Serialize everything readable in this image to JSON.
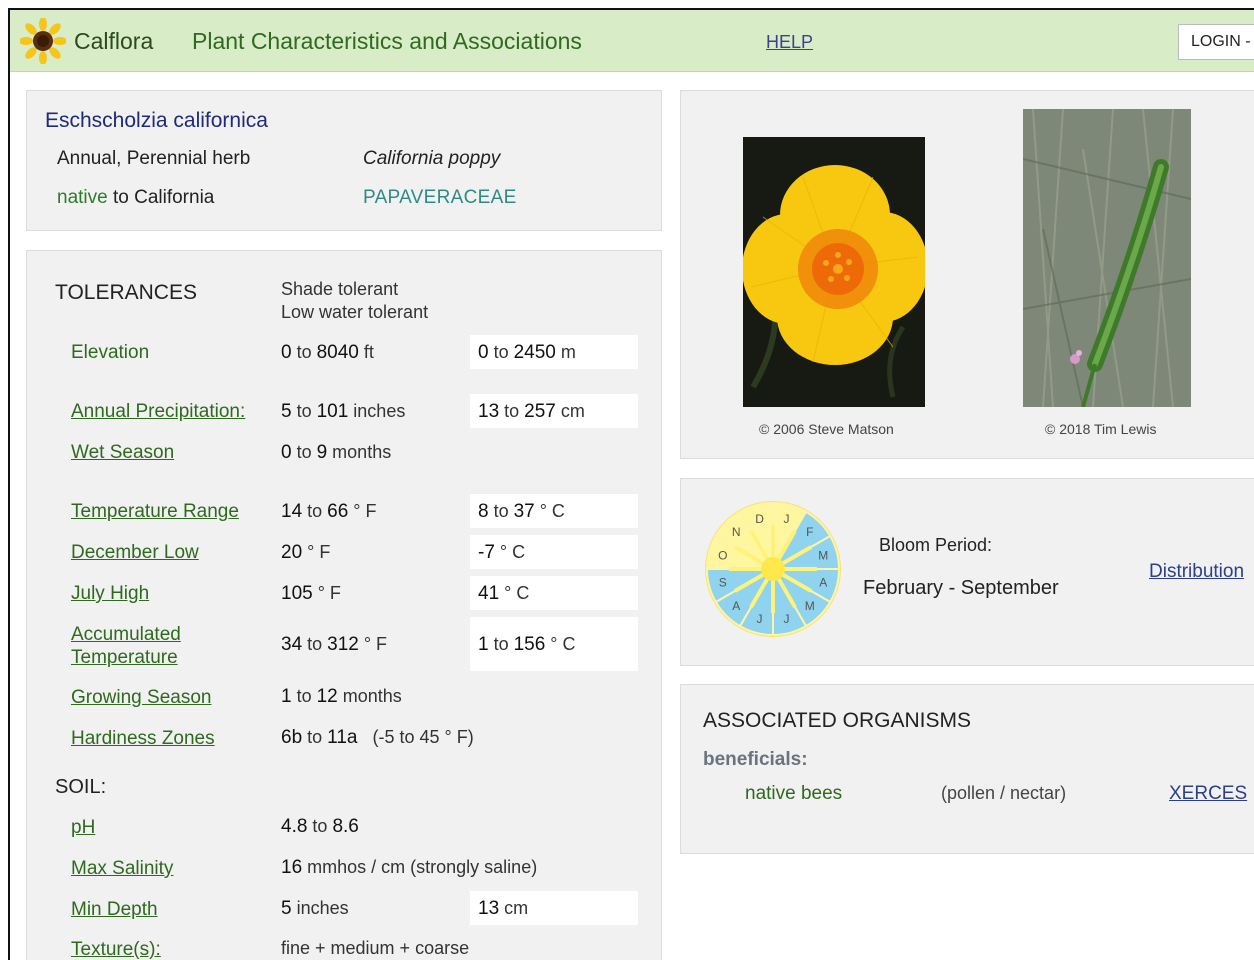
{
  "header": {
    "brand": "Calflora",
    "subtitle": "Plant Characteristics and Associations",
    "help": "HELP",
    "login": "LOGIN -"
  },
  "plant": {
    "scientific_name": "Eschscholzia californica",
    "habit": "Annual, Perennial herb",
    "common_name": "California poppy",
    "native_word": "native",
    "native_rest": " to California",
    "family": "PAPAVERACEAE"
  },
  "tolerances": {
    "title": "TOLERANCES",
    "notes": [
      "Shade tolerant",
      "Low water tolerant"
    ],
    "rows": {
      "elevation": {
        "label": "Elevation",
        "a1": "0",
        "a2": "8040",
        "au": " ft",
        "b1": "0",
        "b2": "2450",
        "bu": " m"
      },
      "precip": {
        "label": "Annual Precipitation:",
        "a1": "5",
        "a2": "101",
        "au": " inches",
        "b1": "13",
        "b2": "257",
        "bu": " cm"
      },
      "wet": {
        "label": "Wet Season",
        "a1": "0",
        "a2": "9",
        "au": " months"
      },
      "temp_range": {
        "label": "Temperature Range",
        "a1": "14",
        "a2": "66",
        "au": " ° F",
        "b1": "8",
        "b2": "37",
        "bu": " ° C"
      },
      "dec_low": {
        "label": "December Low",
        "a": "20",
        "au": " ° F",
        "b": "-7",
        "bu": " ° C"
      },
      "july_high": {
        "label": "July High",
        "a": "105",
        "au": " ° F",
        "b": "41",
        "bu": " ° C"
      },
      "accum": {
        "label1": "Accumulated",
        "label2": "Temperature",
        "a1": "34",
        "a2": "312",
        "au": " ° F",
        "b1": "1",
        "b2": "156",
        "bu": " ° C"
      },
      "growing": {
        "label": "Growing Season",
        "a1": "1",
        "a2": "12",
        "au": " months"
      },
      "hardiness": {
        "label": "Hardiness Zones",
        "a1": "6b",
        "a2": "11a",
        "extra": "(-5 to 45 ° F)"
      }
    },
    "to": " to "
  },
  "soil": {
    "title": "SOIL:",
    "ph": {
      "label": "pH",
      "a1": "4.8",
      "a2": "8.6"
    },
    "salinity": {
      "label": "Max Salinity",
      "a": "16",
      "au": " mmhos / cm (strongly saline)"
    },
    "depth": {
      "label": "Min Depth",
      "a": "5",
      "au": " inches",
      "b": "13",
      "bu": " cm"
    },
    "texture": {
      "label": "Texture(s):",
      "value": "fine + medium + coarse"
    }
  },
  "photos": {
    "credit1": "© 2006 Steve Matson",
    "credit2": "© 2018 Tim Lewis"
  },
  "bloom": {
    "label": "Bloom Period:",
    "value": "February - September",
    "distribution": "Distribution",
    "months": [
      "J",
      "F",
      "M",
      "A",
      "M",
      "J",
      "J",
      "A",
      "S",
      "O",
      "N",
      "D"
    ],
    "bloom_months": [
      2,
      3,
      4,
      5,
      6,
      7,
      8,
      9
    ]
  },
  "associated": {
    "title": "ASSOCIATED ORGANISMS",
    "category": "beneficials:",
    "organism": "native bees",
    "resource": "(pollen / nectar)",
    "link": "XERCES"
  },
  "colors": {
    "header_bg": "#d9ecc8",
    "label_green": "#2e6a1e",
    "link_blue": "#2c3f8a",
    "bloom_blue": "#8fd3ee",
    "wheel_yellow": "#fff6a0"
  }
}
